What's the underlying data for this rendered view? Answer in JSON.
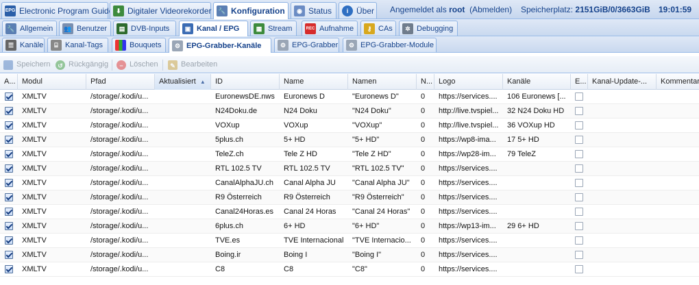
{
  "top_tabs": [
    {
      "label": "Electronic Program Guide",
      "icon": "epg-icon"
    },
    {
      "label": "Digitaler Videorekorder",
      "icon": "download-icon"
    },
    {
      "label": "Konfiguration",
      "icon": "wrench-icon",
      "active": true
    },
    {
      "label": "Status",
      "icon": "eye-icon"
    },
    {
      "label": "Über",
      "icon": "info-icon"
    }
  ],
  "header_info": {
    "logged_in_prefix": "Angemeldet als",
    "user": "root",
    "logout": "(Abmelden)",
    "storage_label": "Speicherplatz:",
    "storage_value": "2151GiB/0/3663GiB",
    "time": "19:01:59"
  },
  "config_tabs": [
    {
      "label": "Allgemein",
      "icon": "wrench-icon"
    },
    {
      "label": "Benutzer",
      "icon": "users-icon"
    },
    {
      "label": "DVB-Inputs",
      "icon": "card-icon"
    },
    {
      "label": "Kanal / EPG",
      "icon": "tv-icon",
      "active": true
    },
    {
      "label": "Stream",
      "icon": "stream-icon"
    },
    {
      "label": "Aufnahme",
      "icon": "record-icon"
    },
    {
      "label": "CAs",
      "icon": "key-icon"
    },
    {
      "label": "Debugging",
      "icon": "bug-icon"
    }
  ],
  "channel_tabs": [
    {
      "label": "Kanäle",
      "icon": "list-icon"
    },
    {
      "label": "Kanal-Tags",
      "icon": "tag-icon"
    },
    {
      "label": "Bouquets",
      "icon": "grid-icon"
    },
    {
      "label": "EPG-Grabber-Kanäle",
      "icon": "gear-icon",
      "active": true
    },
    {
      "label": "EPG-Grabber",
      "icon": "gear-icon"
    },
    {
      "label": "EPG-Grabber-Module",
      "icon": "gear-icon"
    }
  ],
  "toolbar": {
    "save": "Speichern",
    "undo": "Rückgängig",
    "delete": "Löschen",
    "edit": "Bearbeiten"
  },
  "columns": [
    "A...",
    "Modul",
    "Pfad",
    "Aktualisiert",
    "ID",
    "Name",
    "Namen",
    "N...",
    "Logo",
    "Kanäle",
    "E...",
    "Kanal-Update-...",
    "Kommentar"
  ],
  "rows": [
    {
      "enabled": true,
      "modul": "XMLTV",
      "pfad": "/storage/.kodi/u...",
      "aktualisiert": "",
      "id": "EuronewsDE.nws",
      "name": "Euronews D",
      "namen": "\"Euronews D\"",
      "n": "0",
      "logo": "https://services....",
      "kanaele": "106 Euronews [...",
      "e": false
    },
    {
      "enabled": true,
      "modul": "XMLTV",
      "pfad": "/storage/.kodi/u...",
      "aktualisiert": "",
      "id": "N24Doku.de",
      "name": "N24 Doku",
      "namen": "\"N24 Doku\"",
      "n": "0",
      "logo": "http://live.tvspiel...",
      "kanaele": "32 N24 Doku HD",
      "e": false
    },
    {
      "enabled": true,
      "modul": "XMLTV",
      "pfad": "/storage/.kodi/u...",
      "aktualisiert": "",
      "id": "VOXup",
      "name": "VOXup",
      "namen": "\"VOXup\"",
      "n": "0",
      "logo": "http://live.tvspiel...",
      "kanaele": "36 VOXup HD",
      "e": false
    },
    {
      "enabled": true,
      "modul": "XMLTV",
      "pfad": "/storage/.kodi/u...",
      "aktualisiert": "",
      "id": "5plus.ch",
      "name": "5+ HD",
      "namen": "\"5+ HD\"",
      "n": "0",
      "logo": "https://wp8-ima...",
      "kanaele": "17 5+ HD",
      "e": false
    },
    {
      "enabled": true,
      "modul": "XMLTV",
      "pfad": "/storage/.kodi/u...",
      "aktualisiert": "",
      "id": "TeleZ.ch",
      "name": "Tele Z HD",
      "namen": "\"Tele Z HD\"",
      "n": "0",
      "logo": "https://wp28-im...",
      "kanaele": "79 TeleZ",
      "e": false
    },
    {
      "enabled": true,
      "modul": "XMLTV",
      "pfad": "/storage/.kodi/u...",
      "aktualisiert": "",
      "id": "RTL 102.5 TV",
      "name": "RTL 102.5 TV",
      "namen": "\"RTL 102.5 TV\"",
      "n": "0",
      "logo": "https://services....",
      "kanaele": "",
      "e": false
    },
    {
      "enabled": true,
      "modul": "XMLTV",
      "pfad": "/storage/.kodi/u...",
      "aktualisiert": "",
      "id": "CanalAlphaJU.ch",
      "name": "Canal Alpha JU",
      "namen": "\"Canal Alpha JU\"",
      "n": "0",
      "logo": "https://services....",
      "kanaele": "",
      "e": false
    },
    {
      "enabled": true,
      "modul": "XMLTV",
      "pfad": "/storage/.kodi/u...",
      "aktualisiert": "",
      "id": "R9 Österreich",
      "name": "R9 Österreich",
      "namen": "\"R9 Österreich\"",
      "n": "0",
      "logo": "https://services....",
      "kanaele": "",
      "e": false
    },
    {
      "enabled": true,
      "modul": "XMLTV",
      "pfad": "/storage/.kodi/u...",
      "aktualisiert": "",
      "id": "Canal24Horas.es",
      "name": "Canal 24 Horas",
      "namen": "\"Canal 24 Horas\"",
      "n": "0",
      "logo": "https://services....",
      "kanaele": "",
      "e": false
    },
    {
      "enabled": true,
      "modul": "XMLTV",
      "pfad": "/storage/.kodi/u...",
      "aktualisiert": "",
      "id": "6plus.ch",
      "name": "6+ HD",
      "namen": "\"6+ HD\"",
      "n": "0",
      "logo": "https://wp13-im...",
      "kanaele": "29 6+ HD",
      "e": false
    },
    {
      "enabled": true,
      "modul": "XMLTV",
      "pfad": "/storage/.kodi/u...",
      "aktualisiert": "",
      "id": "TVE.es",
      "name": "TVE Internacional",
      "namen": "\"TVE Internacio...",
      "n": "0",
      "logo": "https://services....",
      "kanaele": "",
      "e": false
    },
    {
      "enabled": true,
      "modul": "XMLTV",
      "pfad": "/storage/.kodi/u...",
      "aktualisiert": "",
      "id": "Boing.ir",
      "name": "Boing I",
      "namen": "\"Boing I\"",
      "n": "0",
      "logo": "https://services....",
      "kanaele": "",
      "e": false
    },
    {
      "enabled": true,
      "modul": "XMLTV",
      "pfad": "/storage/.kodi/u...",
      "aktualisiert": "",
      "id": "C8",
      "name": "C8",
      "namen": "\"C8\"",
      "n": "0",
      "logo": "https://services....",
      "kanaele": "",
      "e": false
    }
  ],
  "colors": {
    "accent": "#15428b",
    "border": "#99bbe8",
    "active_tab": "#ffffff"
  }
}
